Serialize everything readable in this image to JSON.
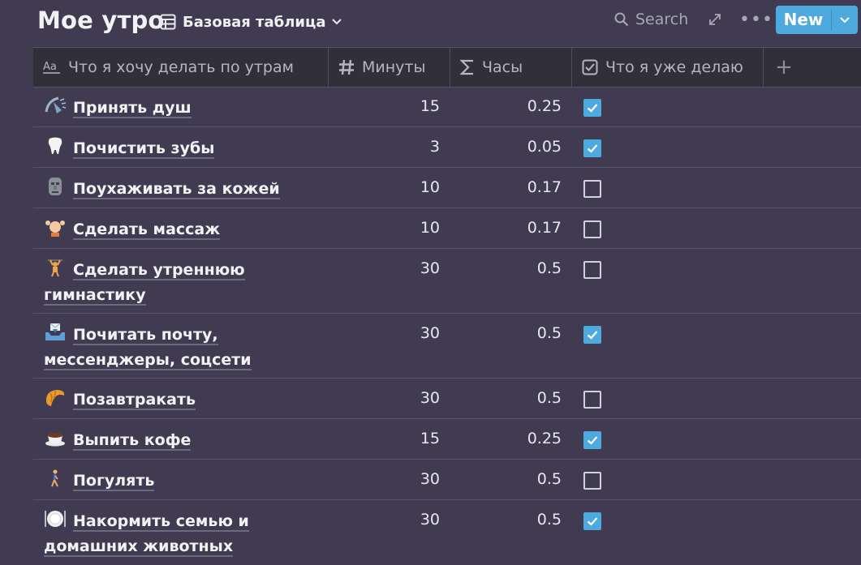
{
  "page": {
    "title": "Мое утро"
  },
  "view": {
    "label": "Базовая таблица"
  },
  "toolbar": {
    "search_label": "Search",
    "new_label": "New"
  },
  "columns": {
    "name": "Что я хочу делать по утрам",
    "minutes": "Минуты",
    "hours": "Часы",
    "done": "Что я уже делаю",
    "add": "+"
  },
  "rows": [
    {
      "icon": "shower-icon",
      "name": "Принять душ",
      "minutes": "15",
      "hours": "0.25",
      "done": true
    },
    {
      "icon": "tooth-icon",
      "name": "Почистить зубы",
      "minutes": "3",
      "hours": "0.05",
      "done": true
    },
    {
      "icon": "moai-icon",
      "name": "Поухаживать за кожей",
      "minutes": "10",
      "hours": "0.17",
      "done": false
    },
    {
      "icon": "massage-icon",
      "name": "Сделать массаж",
      "minutes": "10",
      "hours": "0.17",
      "done": false
    },
    {
      "icon": "weightlifter-icon",
      "name": "Сделать утреннюю гимнастику",
      "minutes": "30",
      "hours": "0.5",
      "done": false
    },
    {
      "icon": "inbox-tray-icon",
      "name": "Почитать почту, мессенджеры, соцсети",
      "minutes": "30",
      "hours": "0.5",
      "done": true
    },
    {
      "icon": "croissant-icon",
      "name": "Позавтракать",
      "minutes": "30",
      "hours": "0.5",
      "done": false
    },
    {
      "icon": "coffee-cup-icon",
      "name": "Выпить кофе",
      "minutes": "15",
      "hours": "0.25",
      "done": true
    },
    {
      "icon": "walking-person-icon",
      "name": "Погулять",
      "minutes": "30",
      "hours": "0.5",
      "done": false
    },
    {
      "icon": "plate-icon",
      "name": "Накормить семью и домашних животных",
      "minutes": "30",
      "hours": "0.5",
      "done": true
    }
  ],
  "colors": {
    "background": "#413b52",
    "header": "#313039",
    "accent": "#4ea9df"
  }
}
